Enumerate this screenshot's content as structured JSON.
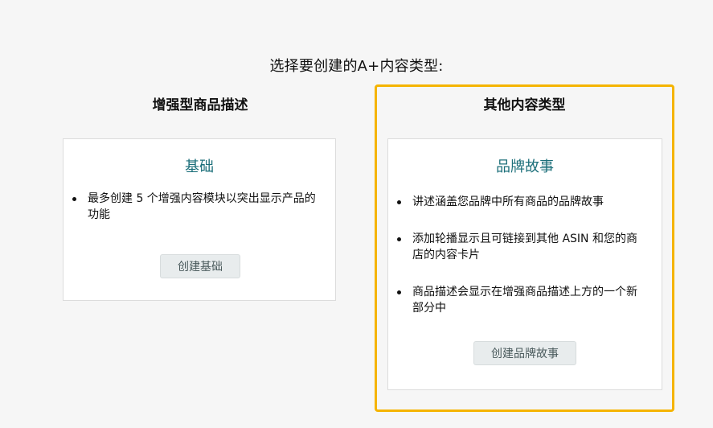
{
  "heading": "选择要创建的A+内容类型:",
  "left_column": {
    "title": "增强型商品描述",
    "card": {
      "title": "基础",
      "bullets": [
        "最多创建 5 个增强内容模块以突出显示产品的功能"
      ],
      "button_label": "创建基础"
    }
  },
  "right_column": {
    "title": "其他内容类型",
    "selected_color": "#f5b400",
    "card": {
      "title": "品牌故事",
      "bullets": [
        "讲述涵盖您品牌中所有商品的品牌故事",
        "添加轮播显示且可链接到其他 ASIN 和您的商店的内容卡片",
        "商品描述会显示在增强商品描述上方的一个新部分中"
      ],
      "button_label": "创建品牌故事"
    }
  },
  "colors": {
    "card_title": "#1c6f7a",
    "background": "#f6f6f6"
  }
}
